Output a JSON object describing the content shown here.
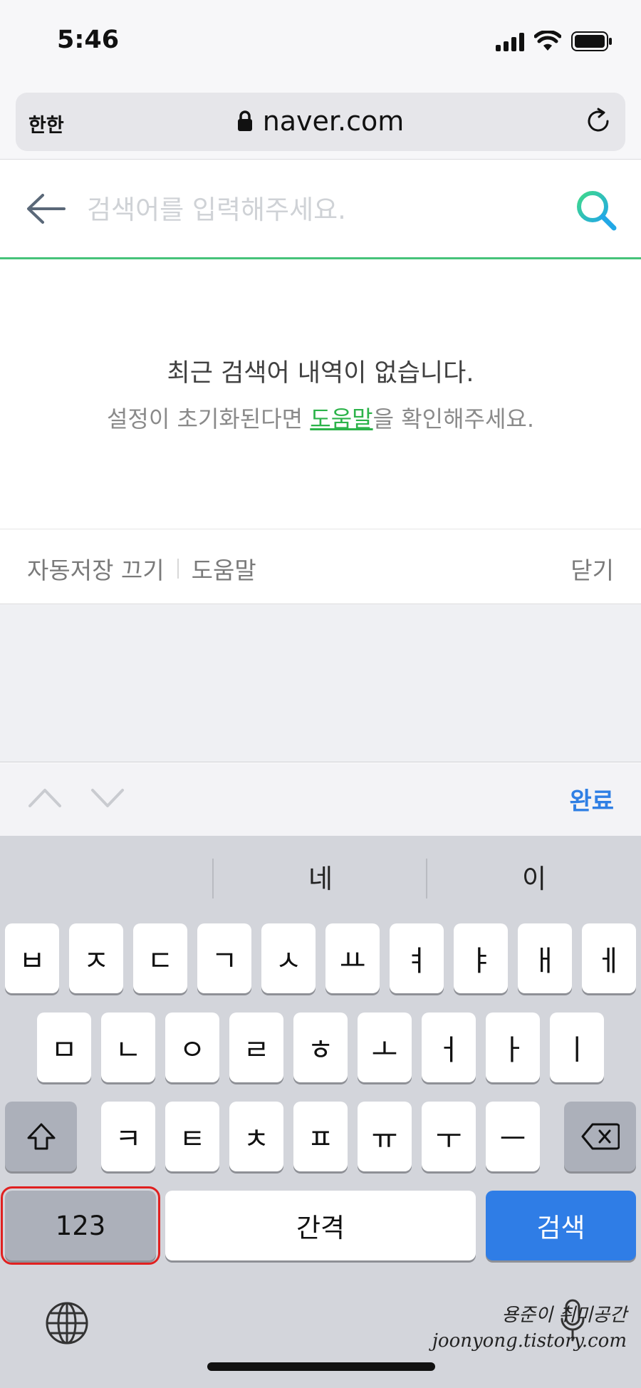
{
  "status_bar": {
    "time": "5:46"
  },
  "browser": {
    "text_size_label": "한한",
    "url": "naver.com"
  },
  "search": {
    "placeholder": "검색어를 입력해주세요."
  },
  "empty_state": {
    "title": "최근 검색어 내역이 없습니다.",
    "desc_before": "설정이 초기화된다면 ",
    "help_link": "도움말",
    "desc_after": "을 확인해주세요."
  },
  "options": {
    "autosave_off": "자동저장 끄기",
    "help": "도움말",
    "close": "닫기"
  },
  "accessory": {
    "done": "완료"
  },
  "keyboard": {
    "suggestions": [
      "",
      "네",
      "이"
    ],
    "row1": [
      "ㅂ",
      "ㅈ",
      "ㄷ",
      "ㄱ",
      "ㅅ",
      "ㅛ",
      "ㅕ",
      "ㅑ",
      "ㅐ",
      "ㅔ"
    ],
    "row2": [
      "ㅁ",
      "ㄴ",
      "ㅇ",
      "ㄹ",
      "ㅎ",
      "ㅗ",
      "ㅓ",
      "ㅏ",
      "ㅣ"
    ],
    "row3": [
      "ㅋ",
      "ㅌ",
      "ㅊ",
      "ㅍ",
      "ㅠ",
      "ㅜ",
      "ㅡ"
    ],
    "numbers_key": "123",
    "space_key": "간격",
    "search_key": "검색"
  },
  "watermark": {
    "line1": "용준이 취미공간",
    "line2": "joonyong.tistory.com"
  }
}
